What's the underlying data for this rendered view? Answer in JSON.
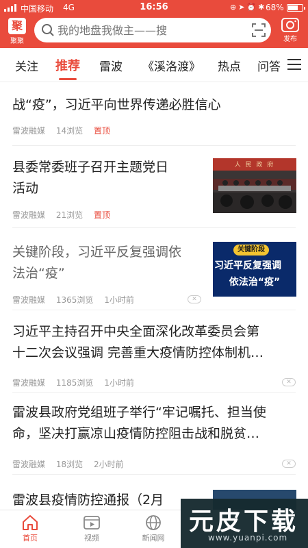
{
  "status_bar": {
    "carrier": "中国移动",
    "network": "4G",
    "time": "16:56",
    "battery": "68%"
  },
  "header": {
    "logo_label": "聚聚",
    "logo_mark": "聚",
    "search_placeholder": "我的地盘我做主——搜",
    "post_label": "发布"
  },
  "tabs": [
    {
      "label": "关注"
    },
    {
      "label": "推荐",
      "active": true
    },
    {
      "label": "雷波"
    },
    {
      "label": "《溪洛渡》"
    },
    {
      "label": "热点"
    },
    {
      "label": "问答"
    }
  ],
  "feed": [
    {
      "title": "战“疫”，习近平向世界传递必胜信心",
      "source": "雷波融媒",
      "views": "14浏览",
      "tag": "置顶"
    },
    {
      "title_lines": [
        "县委常委班子召开主题党日",
        "活动"
      ],
      "source": "雷波融媒",
      "views": "21浏览",
      "tag": "置顶",
      "thumb_caption": "人 民 政 府"
    },
    {
      "title_lines": [
        "关键阶段，习近平反复强调依",
        "法治“疫”"
      ],
      "source": "雷波融媒",
      "views": "1365浏览",
      "time": "1小时前",
      "thumb_badge": "关键阶段",
      "thumb_lines": [
        "习近平反复强调",
        "依法治“疫”"
      ]
    },
    {
      "title_lines": [
        "习近平主持召开中央全面深化改革委员会第",
        "十二次会议强调 完善重大疫情防控体制机…"
      ],
      "source": "雷波融媒",
      "views": "1185浏览",
      "time": "1小时前"
    },
    {
      "title_lines": [
        "雷波县政府党组班子举行“牢记嘱托、担当使",
        "命，坚决打赢凉山疫情防控阻击战和脱贫…"
      ],
      "source": "雷波融媒",
      "views": "18浏览",
      "time": "2小时前"
    },
    {
      "title_lines": [
        "雷波县疫情防控通报（2月"
      ]
    }
  ],
  "bottom_nav": [
    {
      "label": "首页",
      "active": true
    },
    {
      "label": "视频"
    },
    {
      "label": "新闻网"
    }
  ],
  "watermark": {
    "brand": "元皮下载",
    "url": "www.yuanpi.com"
  },
  "colors": {
    "brand_red": "#e94b3c"
  }
}
